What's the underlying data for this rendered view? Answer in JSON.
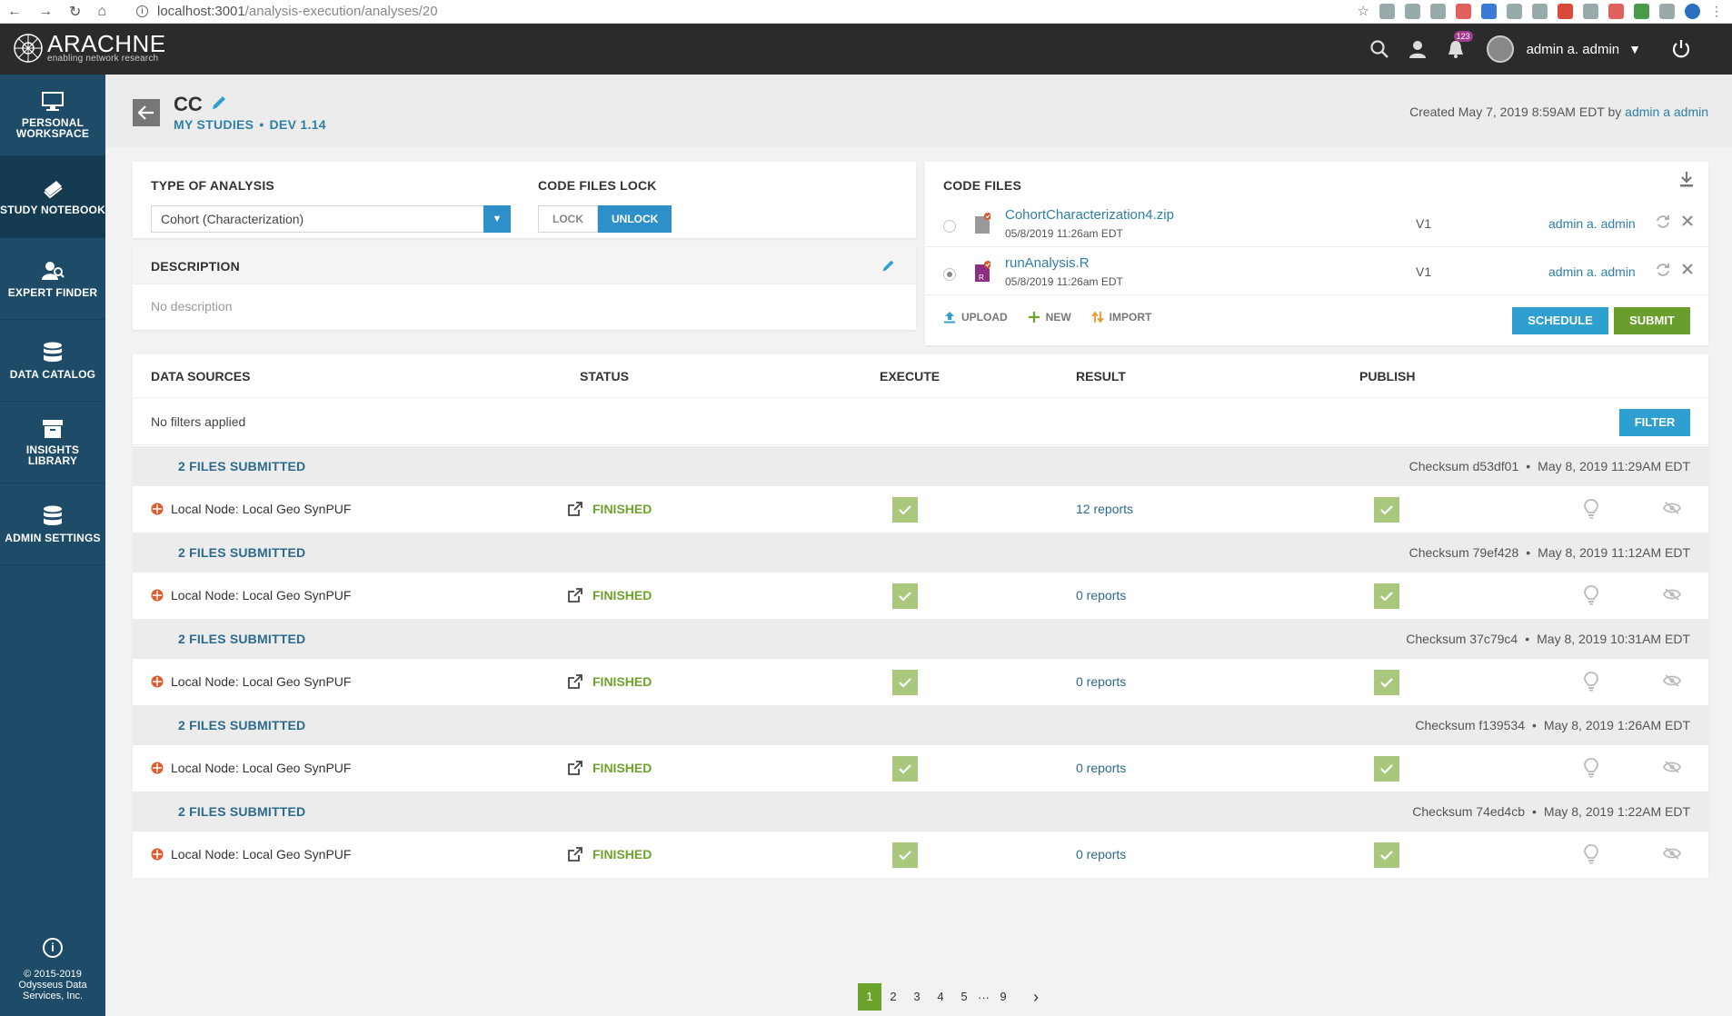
{
  "browser": {
    "url_host": "localhost:3001",
    "url_path": "/analysis-execution/analyses/20"
  },
  "header": {
    "logo_name": "ARACHNE",
    "logo_tagline": "enabling network research",
    "notification_count": "123",
    "user_name": "admin a. admin"
  },
  "sidebar": {
    "items": [
      {
        "label": "PERSONAL WORKSPACE",
        "icon": "monitor-icon"
      },
      {
        "label": "STUDY NOTEBOOK",
        "icon": "notebook-icon"
      },
      {
        "label": "EXPERT FINDER",
        "icon": "experts-icon"
      },
      {
        "label": "DATA CATALOG",
        "icon": "database-icon"
      },
      {
        "label": "INSIGHTS LIBRARY",
        "icon": "archive-icon"
      },
      {
        "label": "ADMIN SETTINGS",
        "icon": "database-icon"
      }
    ],
    "footer_copyright": "© 2015-2019",
    "footer_company_1": "Odysseus Data",
    "footer_company_2": "Services, Inc."
  },
  "page": {
    "title": "CC",
    "breadcrumb_1": "MY STUDIES",
    "breadcrumb_2": "DEV 1.14",
    "created_prefix": "Created May 7, 2019 8:59AM EDT by",
    "created_by": "admin a admin"
  },
  "analysis": {
    "type_label": "TYPE OF ANALYSIS",
    "type_value": "Cohort (Characterization)",
    "lock_label": "CODE FILES LOCK",
    "lock_btn": "LOCK",
    "unlock_btn": "UNLOCK",
    "description_label": "DESCRIPTION",
    "description_text": "No description"
  },
  "code_files": {
    "heading": "CODE FILES",
    "files": [
      {
        "name": "CohortCharacterization4.zip",
        "date": "05/8/2019 11:26am EDT",
        "version": "V1",
        "author": "admin a. admin",
        "selected": false
      },
      {
        "name": "runAnalysis.R",
        "date": "05/8/2019 11:26am EDT",
        "version": "V1",
        "author": "admin a. admin",
        "selected": true
      }
    ],
    "upload": "UPLOAD",
    "new": "NEW",
    "import": "IMPORT",
    "schedule": "SCHEDULE",
    "submit": "SUBMIT"
  },
  "datasources": {
    "col_datasources": "DATA SOURCES",
    "col_status": "STATUS",
    "col_execute": "EXECUTE",
    "col_result": "RESULT",
    "col_publish": "PUBLISH",
    "filters_text": "No filters applied",
    "filter_btn": "FILTER",
    "submissions": [
      {
        "title": "2 FILES SUBMITTED",
        "checksum": "Checksum d53df01",
        "date": "May 8, 2019 11:29AM EDT",
        "node": "Local Node: Local Geo SynPUF",
        "status": "FINISHED",
        "result": "12 reports"
      },
      {
        "title": "2 FILES SUBMITTED",
        "checksum": "Checksum 79ef428",
        "date": "May 8, 2019 11:12AM EDT",
        "node": "Local Node: Local Geo SynPUF",
        "status": "FINISHED",
        "result": "0 reports"
      },
      {
        "title": "2 FILES SUBMITTED",
        "checksum": "Checksum 37c79c4",
        "date": "May 8, 2019 10:31AM EDT",
        "node": "Local Node: Local Geo SynPUF",
        "status": "FINISHED",
        "result": "0 reports"
      },
      {
        "title": "2 FILES SUBMITTED",
        "checksum": "Checksum f139534",
        "date": "May 8, 2019 1:26AM EDT",
        "node": "Local Node: Local Geo SynPUF",
        "status": "FINISHED",
        "result": "0 reports"
      },
      {
        "title": "2 FILES SUBMITTED",
        "checksum": "Checksum 74ed4cb",
        "date": "May 8, 2019 1:22AM EDT",
        "node": "Local Node: Local Geo SynPUF",
        "status": "FINISHED",
        "result": "0 reports"
      }
    ]
  },
  "pagination": {
    "pages": [
      "1",
      "2",
      "3",
      "4",
      "5"
    ],
    "ellipsis": "···",
    "last": "9",
    "next": "›"
  },
  "colors": {
    "sidebar": "#1e4c68",
    "accent_blue": "#2f9fd0",
    "accent_green": "#6ca32b",
    "topbar": "#2b2b2b"
  }
}
